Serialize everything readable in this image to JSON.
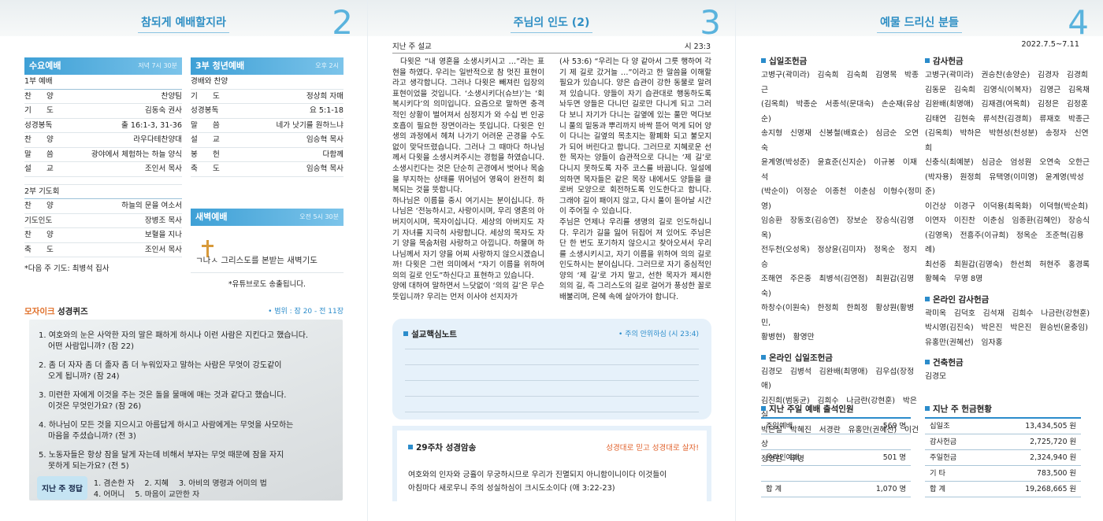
{
  "p2": {
    "title": "참되게 예배할지라",
    "num": "2",
    "wed": {
      "title": "수요예배",
      "time": "저녁 7시 30분",
      "g1": "1부 예배",
      "rows1": [
        [
          "찬　　양",
          "찬양팀"
        ],
        [
          "기　　도",
          "김동숙 권사"
        ],
        [
          "성경봉독",
          "출 16:1-3, 31-36"
        ],
        [
          "찬　　양",
          "라우다테찬양대"
        ],
        [
          "말　　씀",
          "광야에서 체험하는 하늘 양식"
        ],
        [
          "설　　교",
          "조인서 목사"
        ]
      ],
      "g2": "2부 기도회",
      "rows2": [
        [
          "찬　　양",
          "하늘의 문을 여소서"
        ],
        [
          "기도인도",
          "장병조 목사"
        ],
        [
          "찬　　양",
          "보혈을 지나"
        ],
        [
          "축　　도",
          "조인서 목사"
        ]
      ],
      "note": "*다음 주 기도: 최병석 집사"
    },
    "youth": {
      "title": "3부 청년예배",
      "time": "오후 2시",
      "rows": [
        [
          "경배와 찬양",
          ""
        ],
        [
          "기　　도",
          "정상희 자매"
        ],
        [
          "성경봉독",
          "요 5:1-18"
        ],
        [
          "말　　씀",
          "네가 낫기를 원하느냐"
        ],
        [
          "설　　교",
          "임승혁 목사"
        ],
        [
          "봉　　헌",
          "다함께"
        ],
        [
          "축　　도",
          "임승혁 목사"
        ]
      ]
    },
    "dawn": {
      "title": "새벽예배",
      "time": "오전 5시 30분",
      "logo_text": "ㄱ나ㅅ 그리스도를 본받는 새벽기도",
      "note": "*유튜브로도 송출됩니다."
    },
    "quiz": {
      "brand": "모자이크",
      "title": "성경퀴즈",
      "range": "• 범위 : 잠 20 - 전 11장",
      "items": [
        "1. 여호와의 눈은 사악한 자의 말은 패하게 하시나 이런 사람은 지킨다고 했습니다.",
        "어떤 사람입니까? (잠 22)",
        "2. 좀 더 자자 좀 더 졸자 좀 더 누워있자고 말하는 사람은 무엇이 강도같이",
        "오게 됩니까? (잠 24)",
        "3. 미련한 자에게 이것을 주는 것은 돌을 물매에 매는 것과 같다고 했습니다.",
        "이것은 무엇인가요? (잠 26)",
        "4. 하나님이 모든 것을 지으시고 아름답게 하시고 사람에게는 무엇을 사모하는",
        "마음을 주셨습니까? (전 3)",
        "5. 노동자들은 항상 잠을 달게 자는데 비해서 부자는 무엇 때문에 잠을 자지",
        "못하게 되는가요? (전 5)"
      ],
      "ans_label": "지난 주 정답",
      "ans_line1": "1. 겸손한 자　 2. 지혜　 3. 아비의 명령과 어미의 법",
      "ans_line2": "4. 어머니　 5. 마음이 교만한 자"
    }
  },
  "p3": {
    "title": "주님의 인도 (2)",
    "num": "3",
    "label": "지난 주 설교",
    "ref": "시 23:3",
    "col1": "다윗은 “내 영혼을 소생시키시고 …”라는 표현을 하였다. 우리는 일반적으로 참 멋진 표현이라고 생각합니다. 그러나 다윗은 빼져린 입장의 표현이었을 것입니다. ‘소생시키다(슈브)’는 ‘회복시키다’의 의미입니다. 요즘으로 말하면 충격적인 상황이 벌어져서 심정지가 와 수십 번 인공호흡이 필요한 장면이라는 뜻입니다. 다윗은 인생의 과정에서 헤쳐 나가기 어려운 곤경을 수도 없이 맞닥뜨렸습니다. 그러나 그 때마다 하나님께서 다윗을 소생시켜주시는 경험을 하였습니다. 소생시킨다는 것은 단순히 곤경에서 벗어나 목숨을 부지하는 상태를 뛰어넘어 영육이 완전히 회복되는 것을 뜻합니다.\n하나님은 이름을 중시 여기시는 분이십니다. 하나님은 ‘전능하시고, 사랑이시며, 우리 영혼의 아버지이시며, 목자이십니다. 세상의 아버지도 자기 자녀를 지극히 사랑합니다. 세상의 목자도 자기 양을 목숨처럼 사랑하고 아낍니다. 하물며 하나님께서 자기 양을 어찌 사랑하지 않으시겠습니까! 다윗은 그런 의미에서 “자기 이름을 위하여 의의 길로 인도”하신다고 표현하고 있습니다.\n양에 대하여 말하면서 느닷없이 ‘의의 길’은 무슨 뜻입니까? 우리는 먼저 이사야 선지자가",
    "col2": "(사 53:6) “우리는 다 양 같아서 그릇 행하여 각기 제 길로 갔거늘 …”이라고 한 말씀을 이해할 필요가 있습니다. 양은 습관이 강한 동물로 알려져 있습니다. 양들이 자기 습관대로 행동하도록 놔두면 양들은 다니던 길로만 다니게 되고 그러다 보니 자기가 다니는 길옆에 있는 풀만 먹다보니 풀의 밑동과 뿌리까지 바싹 뜯어 먹게 되어 양이 다니는 길옆의 목초지는 황폐화 되고 불모지가 되어 버린다고 합니다. 그러므로 지혜로운 선한 목자는 양들이 습관적으로 다니는 ‘제 길’로 다니지 못하도록 자주 코스를 바꿉니다. 일설에 의하면 목자들은 같은 목장 내에서도 양들을 클로버 모양으로 회전하도록 인도한다고 합니다. 그래야 길이 패이지 않고, 다시 풀이 돋아날 시간이 주어질 수 있습니다.\n주님은 언제나 우리를 생명의 길로 인도하십니다. 우리가 길을 잃어 뒤집어 져 있어도 주님은 단 한 번도 포기하지 않으시고 찾아오셔서 우리를 소생시키시고, 자기 이름을 위하여 의의 길로 인도하시는 분이십니다. 그러므로 자기 중심적인 양의 ‘제 길’로 가지 말고, 선한 목자가 제시한 의의 길, 즉 그리스도의 길로 걸어가 풍성한 꼴로 배불리며, 은혜 속에 살아가야 합니다.",
    "note_title": "설교핵심노트",
    "note_ref": "• 주의 안위하심 (시 23:4)",
    "verse_title": "29주차 성경암송",
    "verse_slogan": "성경대로 믿고 성경대로 살자!",
    "verse1": "여호와의 인자와 긍휼이 무궁하시므로 우리가 진멸되지 아니함이니이다 이것들이",
    "verse2": "아침마다 새로우니 주의 성실하심이 크시도소이다 (애 3:22-23)"
  },
  "p4": {
    "title": "예물 드리신 분들",
    "num": "4",
    "date": "2022.7.5~7.11",
    "tithe_h": "십일조헌금",
    "tithe": "고병구(곽미라)　김숙희　김숙희　김영목　박종근\n(김옥희)　박종순　서종석(문대숙)　손순재(유삼순)\n송지형　신명재　신봉철(배효순)　심금순　오연숙\n윤계영(박성준)　윤효준(신지순)　이규봉　이재석\n(박순이)　이정순　이종천　이춘심　이형수(정미영)\n임승환　장동호(김승연)　장보순　장승식(김영옥)\n전두천(오성옥)　정상윤(김미자)　정옥순　정지승\n조해연　주은중　최병석(김연점)　최원갑(김명숙)\n하창수(이원숙)　한정희　한희정　황상원(황병민,\n황병현)　황영만",
    "online_tithe_h": "온라인 십일조헌금",
    "online_tithe": "김경모　김병석　김완배(최명애)　김우섭(장정애)\n김진희(범동균)　김희수　나금란(강현훈)　박은실\n박은실　박혜진　서경란　유홍만(권혜선)　이건상\n정영란　무명",
    "thanks_h": "감사헌금",
    "thanks": "고병구(곽미라)　권승찬(송양순)　김경자　김경희\n김동문　김숙희　김영식(이복자)　김영근　김옥채\n김완배(최명애)　김재겸(여옥희)　김정은　김정훈\n김태연　김현숙　류석찬(김경희)　류재호　박종근\n(김옥희)　박하은　박현성(천성분)　송정자　신연희\n신충식(최예분)　심금순　엄성원　오연숙　오한근\n(박자용)　원정희　유택영(이미영)　윤계영(박성준)\n이건상　이경구　이덕용(최옥화)　이덕형(박순희)\n이연자　이진찬　이춘심　임종환(김혜인)　장승식\n(김영옥)　전흥주(이규희)　정옥순　조준혁(김용례)\n최선중　최원갑(김명숙)　한선희　허현주　홍경록\n황혜숙　무명 8명",
    "online_thanks_h": "온라인 감사헌금",
    "online_thanks": "곽미옥　김덕호　김석재　김희수　나금란(강현훈)\n박시영(김진숙)　박은진　박은진　원승빈(윤충임)\n유홍만(권혜선)　임자홍",
    "build_h": "건축헌금",
    "build": "김경모",
    "att_h": "지난 주일 예배 출석인원",
    "att": [
      [
        "주일예배",
        "569 명"
      ],
      [
        "",
        ""
      ],
      [
        "온라인예배",
        "501 명"
      ],
      [
        "",
        ""
      ],
      [
        "합 계",
        "1,070 명"
      ]
    ],
    "off_h": "지난 주 헌금현황",
    "off": [
      [
        "십일조",
        "13,434,505 원"
      ],
      [
        "감사헌금",
        "2,725,720 원"
      ],
      [
        "주일헌금",
        "2,324,940 원"
      ],
      [
        "기 타",
        "783,500 원"
      ],
      [
        "합 계",
        "19,268,665 원"
      ]
    ]
  },
  "colors": {
    "accent": "#3ea0d6",
    "title": "#2f8fc4",
    "number": "#5ab3dd",
    "panel": "#e6f1fa"
  }
}
